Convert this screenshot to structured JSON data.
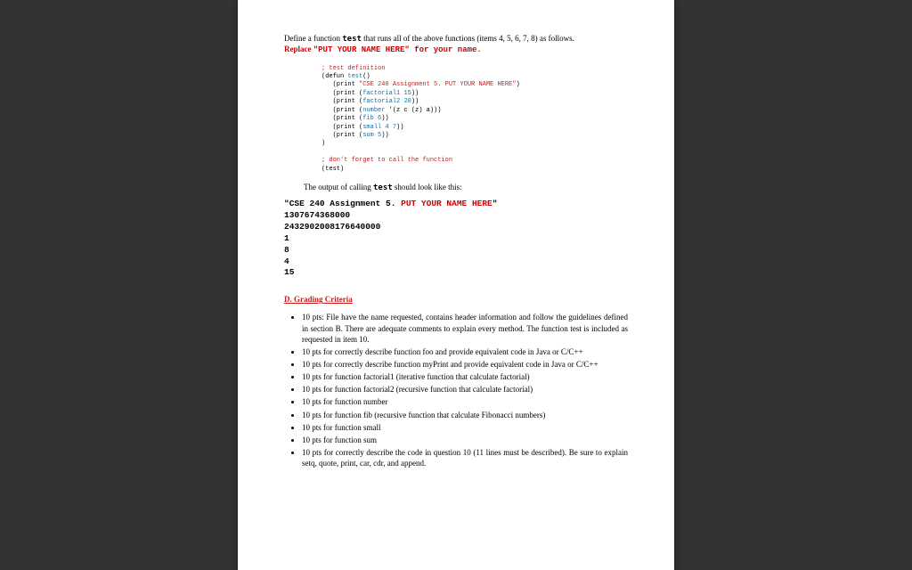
{
  "intro": {
    "pre": "Define a function ",
    "code": "test",
    "post": " that runs all of the above functions (items 4, 5, 6, 7, 8) as follows. ",
    "replace_pre": "Replace ",
    "replace_quote": "\"PUT YOUR NAME HERE\"",
    "replace_post": " for your name."
  },
  "code": {
    "c1": "; test definition",
    "l1a": "(defun ",
    "l1b": "test",
    "l1c": "()",
    "l2a": "   (print ",
    "l2b": "\"CSE 240 Assignment 5. PUT YOUR NAME HERE\"",
    "l2c": ")",
    "l3a": "   (print (",
    "l3fn": "factorial1 ",
    "l3n": "15",
    "l3b": "))",
    "l4a": "   (print (",
    "l4fn": "factorial2 ",
    "l4n": "20",
    "l4b": "))",
    "l5a": "   (print (",
    "l5fn": "number ",
    "l5b": "'(z c (z) a)))",
    "l6a": "   (print (",
    "l6fn": "fib ",
    "l6n": "6",
    "l6b": "))",
    "l7a": "   (print (",
    "l7fn": "small ",
    "l7n": "4 7",
    "l7b": "))",
    "l8a": "   (print (",
    "l8fn": "sum ",
    "l8n": "5",
    "l8b": "))",
    "l9": ")",
    "c2": "; don't forget to call the function",
    "l10": "(test)"
  },
  "outputLead": {
    "pre": "The output of calling ",
    "code": "test",
    "post": " should look like this:"
  },
  "output": {
    "line1_pre": "\"CSE 240 Assignment 5. ",
    "line1_red": "PUT YOUR NAME HERE",
    "line1_post": "\"",
    "v1": "1307674368000",
    "v2": "2432902008176640000",
    "v3": "1",
    "v4": "8",
    "v5": "4",
    "v6": "15"
  },
  "sectionHead": "D. Grading Criteria",
  "grading": [
    "10 pts: File have the name requested, contains header information and follow the guidelines defined in section B. There are adequate comments to explain every method.  The function test is included as requested in item 10.",
    "10 pts for correctly describe function foo and provide equivalent code in Java or C/C++",
    "10 pts for correctly describe function myPrint and provide equivalent code in Java or C/C++",
    "10 pts for function factorial1 (iterative function that calculate factorial)",
    "10 pts for function factorial2 (recursive function that calculate factorial)",
    "10 pts for function number",
    "10 pts for function fib (recursive function that calculate Fibonacci numbers)",
    "10 pts for function small",
    "10 pts for function sum",
    "10 pts for correctly describe the code in question 10 (11 lines must be described). Be sure to explain setq, quote, print, car, cdr, and append."
  ]
}
